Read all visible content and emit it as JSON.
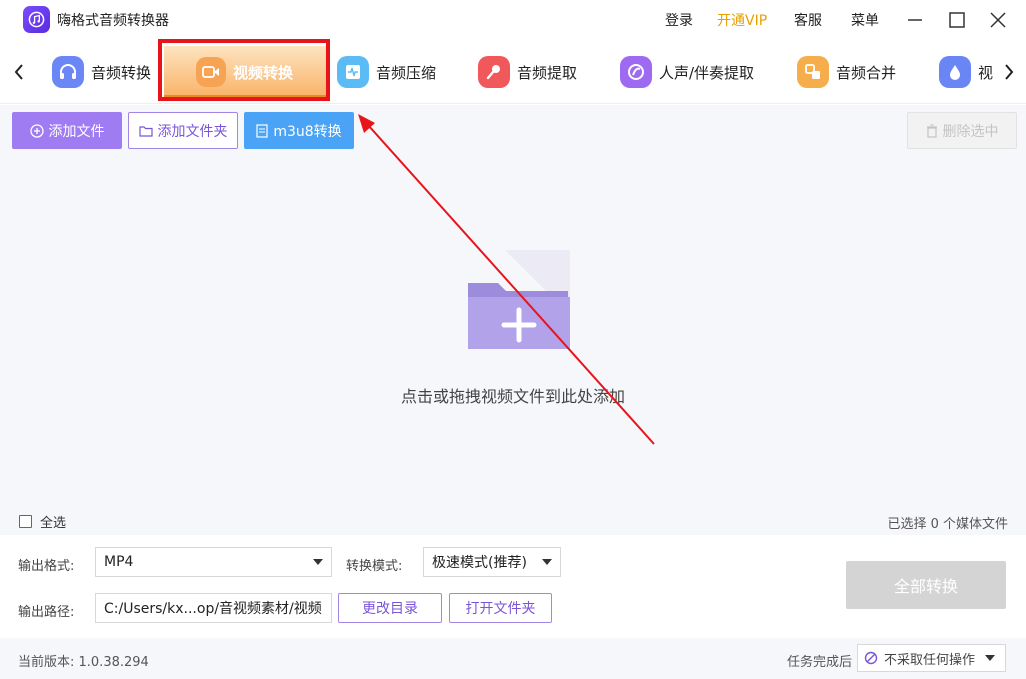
{
  "window": {
    "title": "嗨格式音频转换器",
    "links": {
      "login": "登录",
      "vip": "开通VIP",
      "support": "客服",
      "menu": "菜单"
    }
  },
  "tabs": [
    {
      "label": "音频转换",
      "icon": "headphones-icon",
      "color": "#5b7df5"
    },
    {
      "label": "视频转换",
      "icon": "video-camera-icon",
      "color": "#f39a3a",
      "active": true
    },
    {
      "label": "音频压缩",
      "icon": "audio-compress-icon",
      "color": "#4fb4f5"
    },
    {
      "label": "音频提取",
      "icon": "microphone-icon",
      "color": "#f0555a"
    },
    {
      "label": "人声/伴奏提取",
      "icon": "voice-separate-icon",
      "color": "#9a62f0"
    },
    {
      "label": "音频合并",
      "icon": "merge-icon",
      "color": "#f3a845"
    },
    {
      "label": "视",
      "icon": "droplet-icon",
      "color": "#5b7df5"
    }
  ],
  "toolbar": {
    "add_file": "添加文件",
    "add_folder": "添加文件夹",
    "m3u8": "m3u8转换",
    "delete_selected": "删除选中"
  },
  "dropzone": {
    "hint": "点击或拖拽视频文件到此处添加"
  },
  "selection": {
    "select_all": "全选",
    "count_text": "已选择 0 个媒体文件"
  },
  "settings": {
    "format_label": "输出格式:",
    "format_value": "MP4",
    "mode_label": "转换模式:",
    "mode_value": "极速模式(推荐)",
    "path_label": "输出路径:",
    "path_value": "C:/Users/kx...op/音视频素材/视频",
    "change_dir": "更改目录",
    "open_folder": "打开文件夹",
    "convert_all": "全部转换"
  },
  "status": {
    "version": "当前版本: 1.0.38.294",
    "after_label": "任务完成后",
    "after_value": "不采取任何操作"
  },
  "colors": {
    "accent_purple": "#a07cf3",
    "accent_blue": "#4aa3f5",
    "highlight_red": "#e8141b",
    "vip": "#e6a100"
  }
}
